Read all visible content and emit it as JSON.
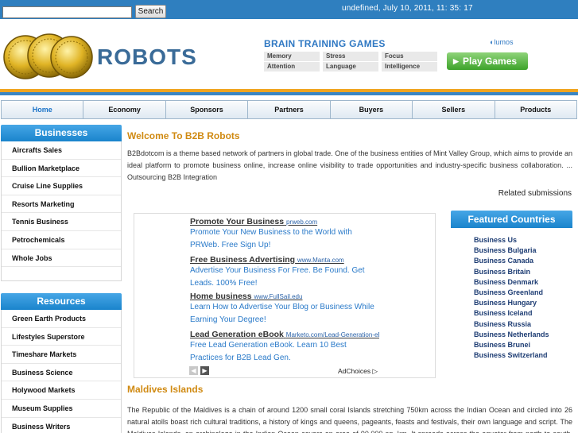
{
  "header": {
    "search_placeholder": "",
    "search_button": "Search",
    "datetime": "undefined, July 10, 2011, 11: 35: 17",
    "logo_text": "ROBOTS",
    "coin_text": "B2B"
  },
  "banner_ad": {
    "title": "BRAIN TRAINING GAMES",
    "cells": [
      "Memory",
      "Stress",
      "Focus",
      "Attention",
      "Language",
      "Intelligence"
    ],
    "brand": "lumos",
    "button": "Play Games"
  },
  "nav": [
    "Home",
    "Economy",
    "Sponsors",
    "Partners",
    "Buyers",
    "Sellers",
    "Products"
  ],
  "businesses": {
    "title": "Businesses",
    "items": [
      "Aircrafts Sales",
      "Bullion Marketplace",
      "Cruise Line Supplies",
      "Resorts Marketing",
      "Tennis Business",
      "Petrochemicals",
      "Whole Jobs"
    ]
  },
  "resources": {
    "title": "Resources",
    "items": [
      "Green Earth Products",
      "Lifestyles Superstore",
      "Timeshare Markets",
      "Business Science",
      "Holywood Markets",
      "Museum Supplies",
      "Business Writers"
    ]
  },
  "main": {
    "welcome": "Welcome To B2B Robots",
    "intro": "B2Bdotcom is a theme based network of partners in global trade. One of the business entities of Mint Valley Group, which aims to provide an ideal platform to promote business online, increase online visibility to trade opportunities and industry-specific business collaboration. ... Outsourcing B2B Integration",
    "related": "Related submissions",
    "maldives_title": "Maldives Islands",
    "maldives_text": "The Republic of the Maldives is a chain of around 1200 small coral Islands stretching 750km across the Indian Ocean and circled into 26 natural atolls boast rich cultural traditions, a history of kings and queens, pageants, feasts and festivals, their own language and script. The Maldives Islands, an archipelago in the Indian Ocean covers an area of 90,000 sq. km. It spreads across the equator from north to south. The"
  },
  "ads": {
    "units": [
      {
        "title": "Promote Your Business",
        "url": "prweb.com",
        "text": "Promote Your New Business to the World with PRWeb. Free Sign Up!"
      },
      {
        "title": "Free Business Advertising",
        "url": "www.Manta.com",
        "text": "Advertise Your Business For Free. Be Found. Get Leads. 100% Free!"
      },
      {
        "title": "Home business",
        "url": "www.FullSail.edu",
        "text": "Learn How to Advertise Your Blog or Business While Earning Your Degree!"
      },
      {
        "title": "Lead Generation eBook",
        "url": "Marketo.com/Lead-Generation-eBook",
        "text": "Free Lead Generation eBook. Learn 10 Best Practices for B2B Lead Gen."
      }
    ],
    "adchoices": "AdChoices"
  },
  "featured": {
    "title": "Featured Countries",
    "items": [
      "Business Us",
      "Business Bulgaria",
      "Business Canada",
      "Business Britain",
      "Business Denmark",
      "Business Greenland",
      "Business Hungary",
      "Business Iceland",
      "Business Russia",
      "Business Netherlands",
      "Business Brunei",
      "Business Switzerland"
    ]
  },
  "colors": {
    "top_strip": "#2f7fbf",
    "accent_orange": "#f0a520",
    "heading_gold": "#d08a12",
    "panel_blue": "#1a84cc",
    "link_blue": "#2a7ac9"
  }
}
